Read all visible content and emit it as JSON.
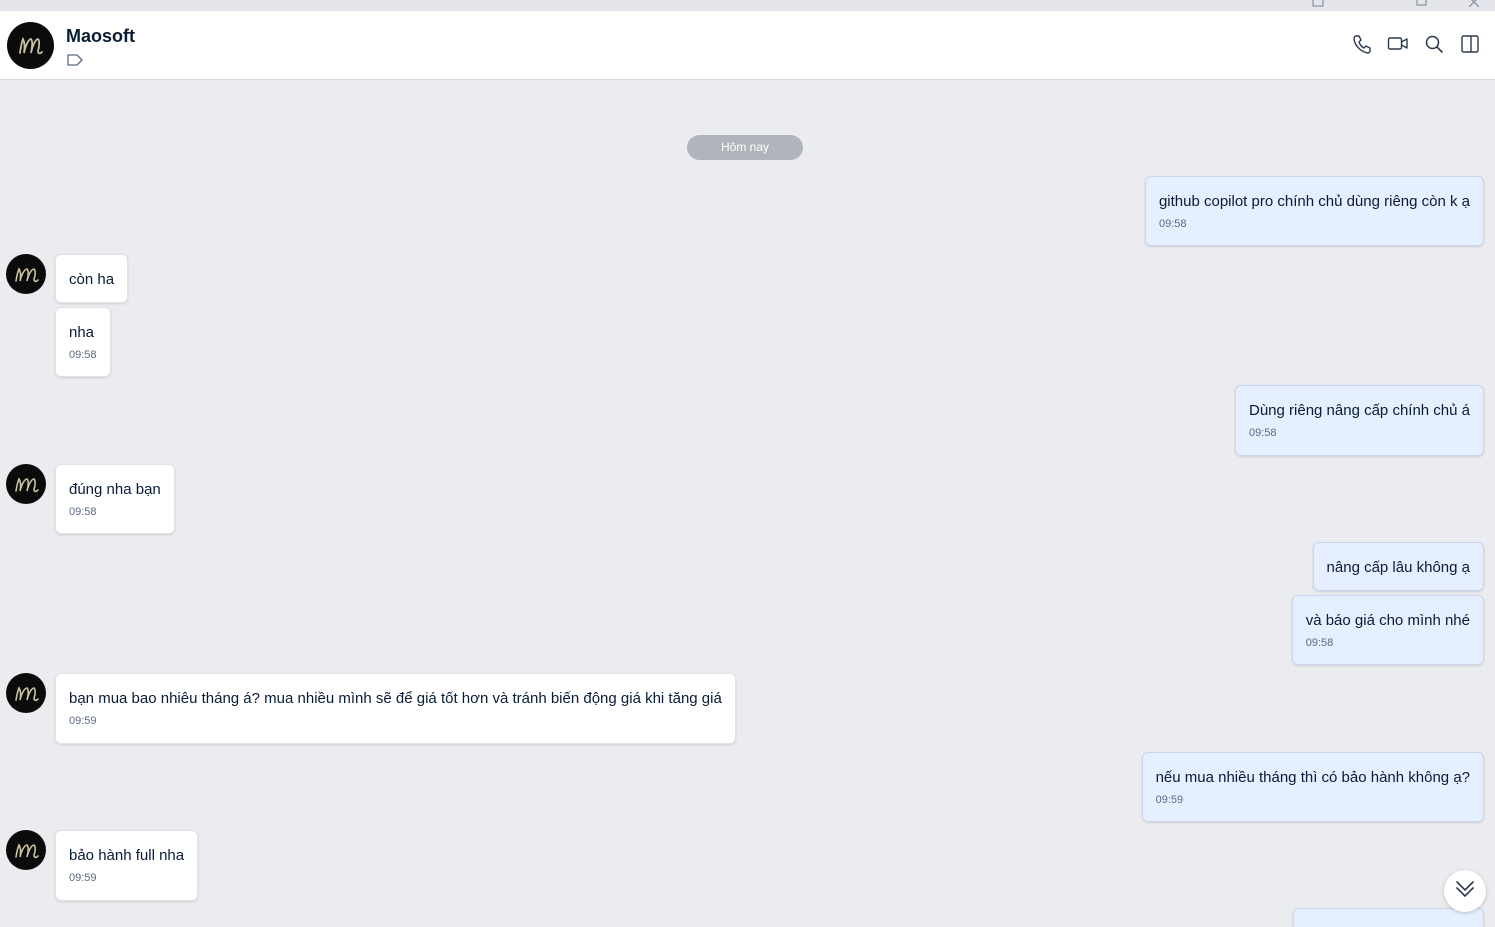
{
  "header": {
    "name": "Maosoft",
    "actions": [
      "phone-icon",
      "video-icon",
      "search-icon",
      "sidebar-toggle-icon"
    ]
  },
  "chat": {
    "date_separator": "Hôm nay",
    "messages": [
      {
        "side": "out",
        "text": "github copilot pro chính chủ dùng riêng còn k ạ",
        "time": "09:58"
      },
      {
        "side": "in",
        "text": "còn ha",
        "time": ""
      },
      {
        "side": "in",
        "text": "nha",
        "time": "09:58"
      },
      {
        "side": "out",
        "text": "Dùng riêng nâng cấp chính chủ á",
        "time": "09:58"
      },
      {
        "side": "in",
        "text": "đúng nha bạn",
        "time": "09:58"
      },
      {
        "side": "out",
        "text": "nâng cấp lâu không ạ",
        "time": ""
      },
      {
        "side": "out",
        "text": "và báo giá cho mình nhé",
        "time": "09:58"
      },
      {
        "side": "in",
        "text": "bạn mua bao nhiêu tháng á? mua nhiều mình sẽ để giá tốt hơn và tránh biến động giá khi tăng giá",
        "time": "09:59"
      },
      {
        "side": "out",
        "text": "nếu mua nhiều tháng thì có bảo hành không ạ?",
        "time": "09:59"
      },
      {
        "side": "in",
        "text": "bảo hành full nha",
        "time": "09:59"
      }
    ]
  },
  "colors": {
    "background": "#ebecf0",
    "incoming_bubble": "#ffffff",
    "outgoing_bubble": "#e5efff",
    "text": "#081c36"
  }
}
